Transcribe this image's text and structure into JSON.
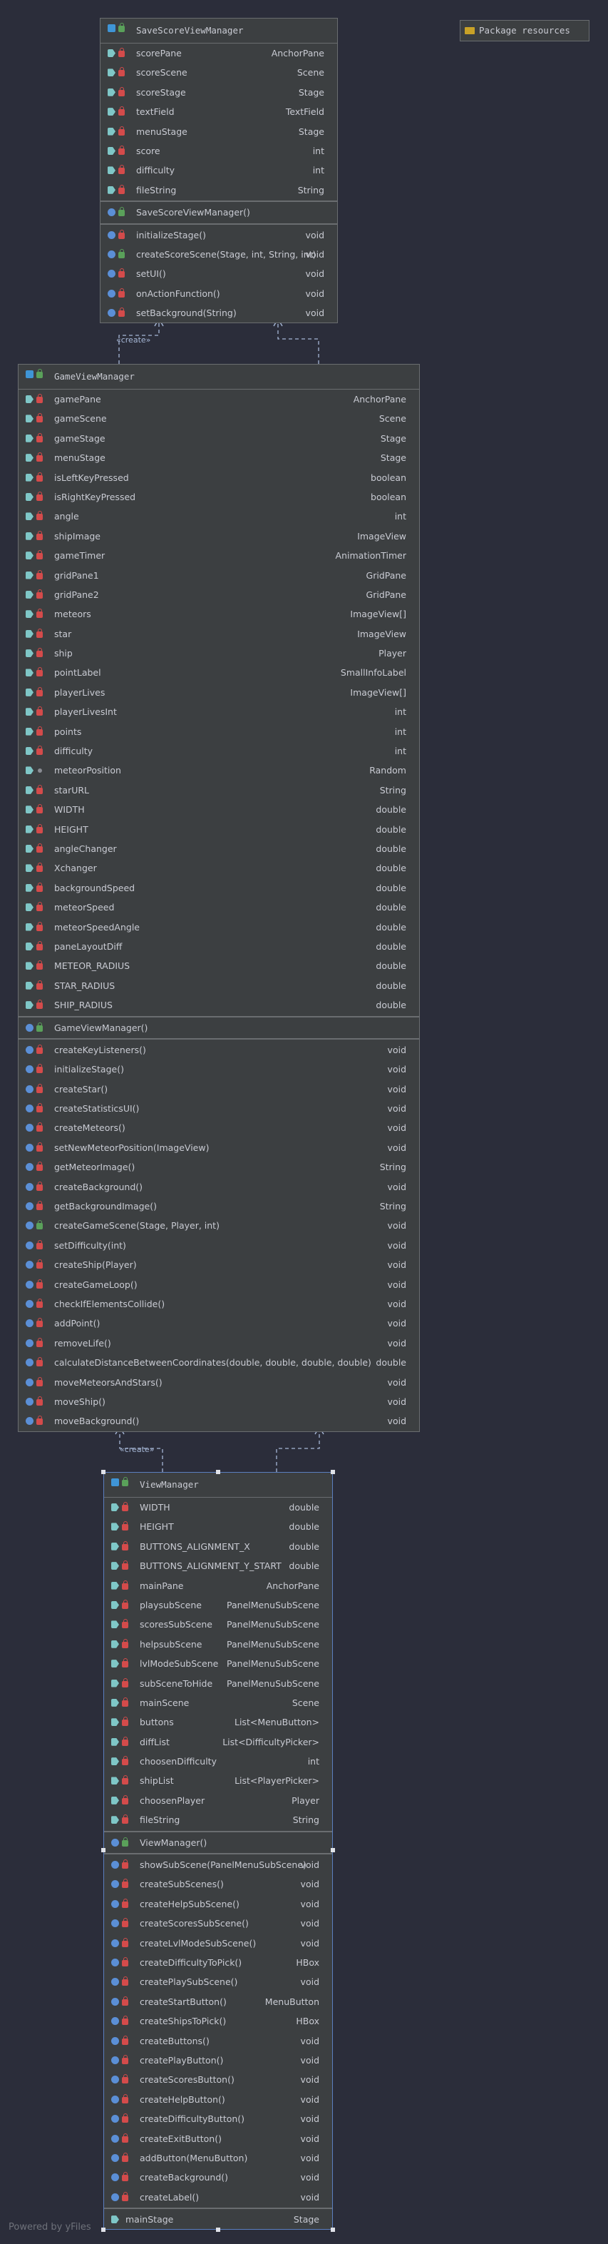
{
  "package_box": {
    "icon": "folder-icon",
    "label": "Package resources"
  },
  "footer": {
    "text": "Powered by yFiles"
  },
  "relations": {
    "create_label": "«create»"
  },
  "classes": {
    "save": {
      "name": "SaveScoreViewManager",
      "fields": [
        {
          "name": "scorePane",
          "type": "AnchorPane",
          "visibility": "private"
        },
        {
          "name": "scoreScene",
          "type": "Scene",
          "visibility": "private"
        },
        {
          "name": "scoreStage",
          "type": "Stage",
          "visibility": "private"
        },
        {
          "name": "textField",
          "type": "TextField",
          "visibility": "private"
        },
        {
          "name": "menuStage",
          "type": "Stage",
          "visibility": "private"
        },
        {
          "name": "score",
          "type": "int",
          "visibility": "private"
        },
        {
          "name": "difficulty",
          "type": "int",
          "visibility": "private"
        },
        {
          "name": "fileString",
          "type": "String",
          "visibility": "private"
        }
      ],
      "constructors": [
        {
          "name": "SaveScoreViewManager()",
          "type": "",
          "visibility": "public"
        }
      ],
      "methods": [
        {
          "name": "initializeStage()",
          "type": "void",
          "visibility": "private"
        },
        {
          "name": "createScoreScene(Stage, int, String, int)",
          "type": "void",
          "visibility": "public"
        },
        {
          "name": "setUI()",
          "type": "void",
          "visibility": "private"
        },
        {
          "name": "onActionFunction()",
          "type": "void",
          "visibility": "private"
        },
        {
          "name": "setBackground(String)",
          "type": "void",
          "visibility": "private"
        }
      ]
    },
    "game": {
      "name": "GameViewManager",
      "fields": [
        {
          "name": "gamePane",
          "type": "AnchorPane",
          "visibility": "private"
        },
        {
          "name": "gameScene",
          "type": "Scene",
          "visibility": "private"
        },
        {
          "name": "gameStage",
          "type": "Stage",
          "visibility": "private"
        },
        {
          "name": "menuStage",
          "type": "Stage",
          "visibility": "private"
        },
        {
          "name": "isLeftKeyPressed",
          "type": "boolean",
          "visibility": "private"
        },
        {
          "name": "isRightKeyPressed",
          "type": "boolean",
          "visibility": "private"
        },
        {
          "name": "angle",
          "type": "int",
          "visibility": "private"
        },
        {
          "name": "shipImage",
          "type": "ImageView",
          "visibility": "private"
        },
        {
          "name": "gameTimer",
          "type": "AnimationTimer",
          "visibility": "private"
        },
        {
          "name": "gridPane1",
          "type": "GridPane",
          "visibility": "private"
        },
        {
          "name": "gridPane2",
          "type": "GridPane",
          "visibility": "private"
        },
        {
          "name": "meteors",
          "type": "ImageView[]",
          "visibility": "private"
        },
        {
          "name": "star",
          "type": "ImageView",
          "visibility": "private"
        },
        {
          "name": "ship",
          "type": "Player",
          "visibility": "private"
        },
        {
          "name": "pointLabel",
          "type": "SmallInfoLabel",
          "visibility": "private"
        },
        {
          "name": "playerLives",
          "type": "ImageView[]",
          "visibility": "private"
        },
        {
          "name": "playerLivesInt",
          "type": "int",
          "visibility": "private"
        },
        {
          "name": "points",
          "type": "int",
          "visibility": "private"
        },
        {
          "name": "difficulty",
          "type": "int",
          "visibility": "private"
        },
        {
          "name": "meteorPosition",
          "type": "Random",
          "visibility": "package"
        },
        {
          "name": "starURL",
          "type": "String",
          "visibility": "private"
        },
        {
          "name": "WIDTH",
          "type": "double",
          "visibility": "private"
        },
        {
          "name": "HEIGHT",
          "type": "double",
          "visibility": "private"
        },
        {
          "name": "angleChanger",
          "type": "double",
          "visibility": "private"
        },
        {
          "name": "Xchanger",
          "type": "double",
          "visibility": "private"
        },
        {
          "name": "backgroundSpeed",
          "type": "double",
          "visibility": "private"
        },
        {
          "name": "meteorSpeed",
          "type": "double",
          "visibility": "private"
        },
        {
          "name": "meteorSpeedAngle",
          "type": "double",
          "visibility": "private"
        },
        {
          "name": "paneLayoutDiff",
          "type": "double",
          "visibility": "private"
        },
        {
          "name": "METEOR_RADIUS",
          "type": "double",
          "visibility": "private"
        },
        {
          "name": "STAR_RADIUS",
          "type": "double",
          "visibility": "private"
        },
        {
          "name": "SHIP_RADIUS",
          "type": "double",
          "visibility": "private"
        }
      ],
      "constructors": [
        {
          "name": "GameViewManager()",
          "type": "",
          "visibility": "public"
        }
      ],
      "methods": [
        {
          "name": "createKeyListeners()",
          "type": "void",
          "visibility": "private"
        },
        {
          "name": "initializeStage()",
          "type": "void",
          "visibility": "private"
        },
        {
          "name": "createStar()",
          "type": "void",
          "visibility": "private"
        },
        {
          "name": "createStatisticsUI()",
          "type": "void",
          "visibility": "private"
        },
        {
          "name": "createMeteors()",
          "type": "void",
          "visibility": "private"
        },
        {
          "name": "setNewMeteorPosition(ImageView)",
          "type": "void",
          "visibility": "private"
        },
        {
          "name": "getMeteorImage()",
          "type": "String",
          "visibility": "private"
        },
        {
          "name": "createBackground()",
          "type": "void",
          "visibility": "private"
        },
        {
          "name": "getBackgroundImage()",
          "type": "String",
          "visibility": "private"
        },
        {
          "name": "createGameScene(Stage, Player, int)",
          "type": "void",
          "visibility": "public"
        },
        {
          "name": "setDifficulty(int)",
          "type": "void",
          "visibility": "private"
        },
        {
          "name": "createShip(Player)",
          "type": "void",
          "visibility": "private"
        },
        {
          "name": "createGameLoop()",
          "type": "void",
          "visibility": "private"
        },
        {
          "name": "checkIfElementsCollide()",
          "type": "void",
          "visibility": "private"
        },
        {
          "name": "addPoint()",
          "type": "void",
          "visibility": "private"
        },
        {
          "name": "removeLife()",
          "type": "void",
          "visibility": "private"
        },
        {
          "name": "calculateDistanceBetweenCoordinates(double, double, double, double)",
          "type": "double",
          "visibility": "private"
        },
        {
          "name": "moveMeteorsAndStars()",
          "type": "void",
          "visibility": "private"
        },
        {
          "name": "moveShip()",
          "type": "void",
          "visibility": "private"
        },
        {
          "name": "moveBackground()",
          "type": "void",
          "visibility": "private"
        }
      ]
    },
    "view": {
      "name": "ViewManager",
      "fields": [
        {
          "name": "WIDTH",
          "type": "double",
          "visibility": "private"
        },
        {
          "name": "HEIGHT",
          "type": "double",
          "visibility": "private"
        },
        {
          "name": "BUTTONS_ALIGNMENT_X",
          "type": "double",
          "visibility": "private"
        },
        {
          "name": "BUTTONS_ALIGNMENT_Y_START",
          "type": "double",
          "visibility": "private"
        },
        {
          "name": "mainPane",
          "type": "AnchorPane",
          "visibility": "private"
        },
        {
          "name": "playsubScene",
          "type": "PanelMenuSubScene",
          "visibility": "private"
        },
        {
          "name": "scoresSubScene",
          "type": "PanelMenuSubScene",
          "visibility": "private"
        },
        {
          "name": "helpsubScene",
          "type": "PanelMenuSubScene",
          "visibility": "private"
        },
        {
          "name": "lvlModeSubScene",
          "type": "PanelMenuSubScene",
          "visibility": "private"
        },
        {
          "name": "subSceneToHide",
          "type": "PanelMenuSubScene",
          "visibility": "private"
        },
        {
          "name": "mainScene",
          "type": "Scene",
          "visibility": "private"
        },
        {
          "name": "buttons",
          "type": "List<MenuButton>",
          "visibility": "private"
        },
        {
          "name": "diffList",
          "type": "List<DifficultyPicker>",
          "visibility": "private"
        },
        {
          "name": "choosenDifficulty",
          "type": "int",
          "visibility": "private"
        },
        {
          "name": "shipList",
          "type": "List<PlayerPicker>",
          "visibility": "private"
        },
        {
          "name": "choosenPlayer",
          "type": "Player",
          "visibility": "private"
        },
        {
          "name": "fileString",
          "type": "String",
          "visibility": "private"
        }
      ],
      "constructors": [
        {
          "name": "ViewManager()",
          "type": "",
          "visibility": "public"
        }
      ],
      "methods": [
        {
          "name": "showSubScene(PanelMenuSubScene)",
          "type": "void",
          "visibility": "private"
        },
        {
          "name": "createSubScenes()",
          "type": "void",
          "visibility": "private"
        },
        {
          "name": "createHelpSubScene()",
          "type": "void",
          "visibility": "private"
        },
        {
          "name": "createScoresSubScene()",
          "type": "void",
          "visibility": "private"
        },
        {
          "name": "createLvlModeSubScene()",
          "type": "void",
          "visibility": "private"
        },
        {
          "name": "createDifficultyToPick()",
          "type": "HBox",
          "visibility": "private"
        },
        {
          "name": "createPlaySubScene()",
          "type": "void",
          "visibility": "private"
        },
        {
          "name": "createStartButton()",
          "type": "MenuButton",
          "visibility": "private"
        },
        {
          "name": "createShipsToPick()",
          "type": "HBox",
          "visibility": "private"
        },
        {
          "name": "createButtons()",
          "type": "void",
          "visibility": "private"
        },
        {
          "name": "createPlayButton()",
          "type": "void",
          "visibility": "private"
        },
        {
          "name": "createScoresButton()",
          "type": "void",
          "visibility": "private"
        },
        {
          "name": "createHelpButton()",
          "type": "void",
          "visibility": "private"
        },
        {
          "name": "createDifficultyButton()",
          "type": "void",
          "visibility": "private"
        },
        {
          "name": "createExitButton()",
          "type": "void",
          "visibility": "private"
        },
        {
          "name": "addButton(MenuButton)",
          "type": "void",
          "visibility": "private"
        },
        {
          "name": "createBackground()",
          "type": "void",
          "visibility": "private"
        },
        {
          "name": "createLabel()",
          "type": "void",
          "visibility": "private"
        }
      ],
      "properties": [
        {
          "name": "mainStage",
          "type": "Stage"
        }
      ]
    }
  }
}
